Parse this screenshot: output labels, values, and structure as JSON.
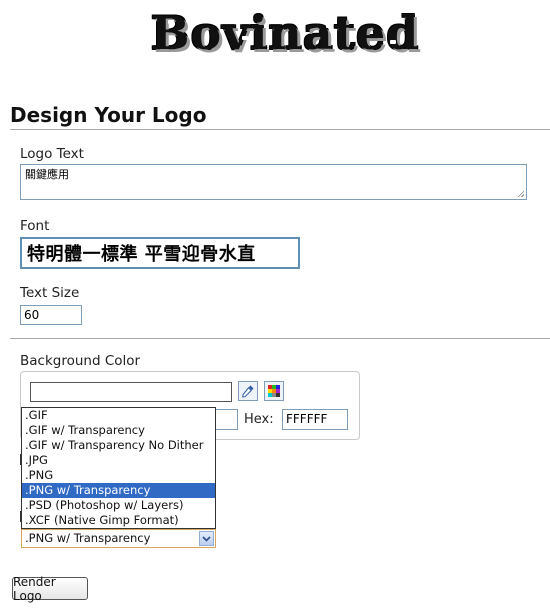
{
  "header": {
    "logo_text": "Bovinated"
  },
  "page_title": "Design Your Logo",
  "logo_text_field": {
    "label": "Logo Text",
    "value": "關鍵應用"
  },
  "font_field": {
    "label": "Font",
    "preview_text": "特明體一標準 平雪迎骨水直"
  },
  "text_size_field": {
    "label": "Text Size",
    "value": "60"
  },
  "background_color": {
    "label": "Background Color",
    "color_value": "",
    "hex_label": "Hex:",
    "hex_value": "FFFFFF"
  },
  "format_select": {
    "selected": ".PNG w/ Transparency",
    "options": [
      ".GIF",
      ".GIF w/ Transparency",
      ".GIF w/ Transparency No Dither",
      ".JPG",
      ".PNG",
      ".PNG w/ Transparency",
      ".PSD (Photoshop w/ Layers)",
      ".XCF (Native Gimp Format)"
    ],
    "highlighted_index": 5
  },
  "render_button": {
    "label": "Render Logo"
  },
  "colors": {
    "heading": "#111111",
    "input_border": "#7f9db9",
    "highlight": "#316ac5",
    "select_focus_border": "#d6a85c"
  }
}
